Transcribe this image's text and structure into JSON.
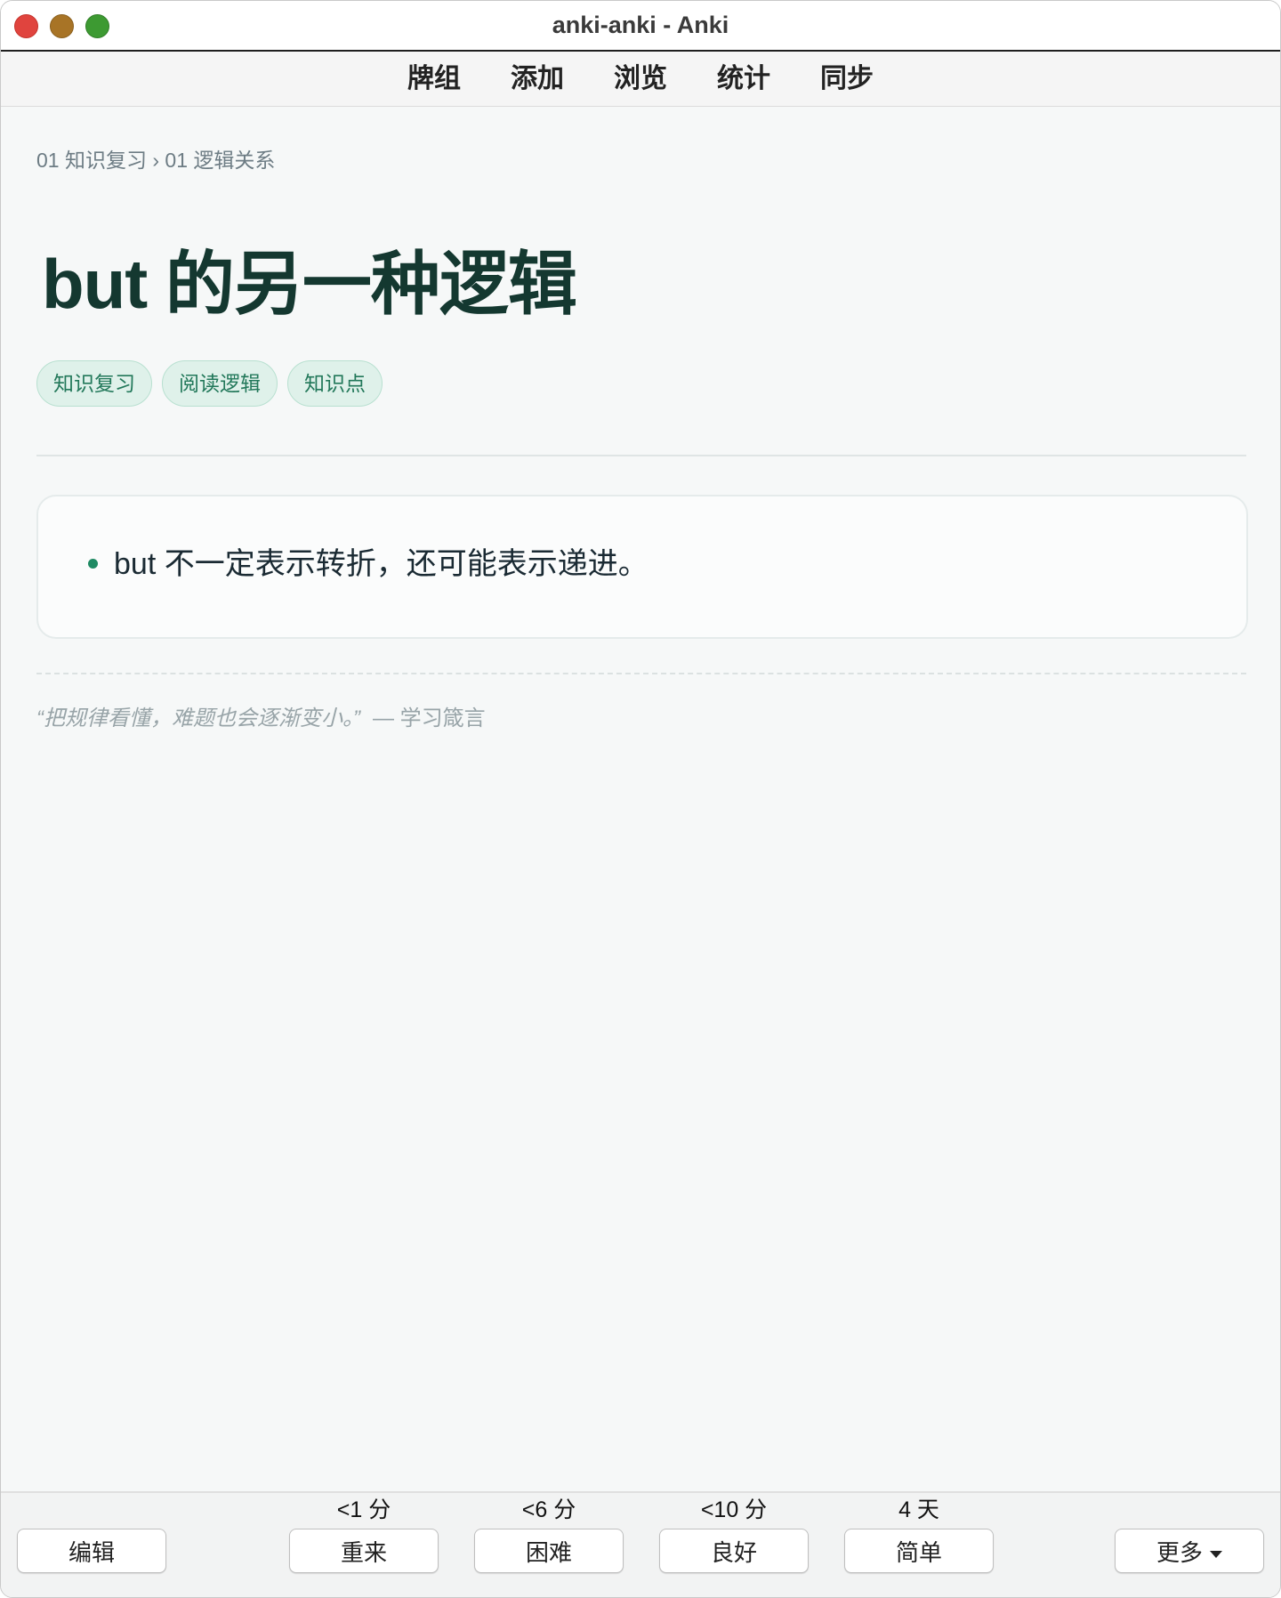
{
  "window": {
    "title": "anki-anki - Anki"
  },
  "toolbar": {
    "items": [
      "牌组",
      "添加",
      "浏览",
      "统计",
      "同步"
    ]
  },
  "card": {
    "breadcrumb": "01 知识复习 › 01 逻辑关系",
    "title": "but 的另一种逻辑",
    "tags": [
      "知识复习",
      "阅读逻辑",
      "知识点"
    ],
    "notes": [
      "but 不一定表示转折，还可能表示递进。"
    ],
    "quote": {
      "text": "“把规律看懂，难题也会逐渐变小。”",
      "source": "— 学习箴言"
    }
  },
  "bottom": {
    "edit_label": "编辑",
    "more_label": "更多",
    "answers": [
      {
        "interval": "<1 分",
        "label": "重来"
      },
      {
        "interval": "<6 分",
        "label": "困难"
      },
      {
        "interval": "<10 分",
        "label": "良好"
      },
      {
        "interval": "4 天",
        "label": "简单"
      }
    ]
  },
  "colors": {
    "accent": "#1f8a63",
    "title_text": "#143830",
    "tag_bg": "#dff1ea",
    "traffic_close": "#e0443e",
    "traffic_min": "#a87426",
    "traffic_max": "#3d9a32"
  }
}
